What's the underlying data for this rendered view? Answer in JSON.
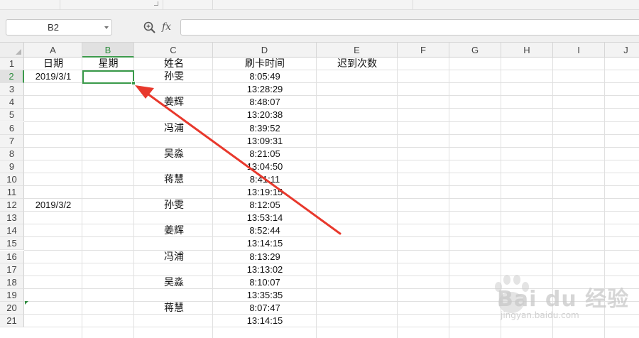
{
  "namebox": {
    "value": "B2"
  },
  "formula": {
    "fx_label": "fx",
    "value": ""
  },
  "columns": [
    "A",
    "B",
    "C",
    "D",
    "E",
    "F",
    "G",
    "H",
    "I",
    "J"
  ],
  "rows": [
    "1",
    "2",
    "3",
    "4",
    "5",
    "6",
    "7",
    "8",
    "9",
    "10",
    "11",
    "12",
    "13",
    "14",
    "15",
    "16",
    "17",
    "18",
    "19",
    "20",
    "21"
  ],
  "active_cell": "B2",
  "cells": {
    "A1": "日期",
    "B1": "星期",
    "C1": "姓名",
    "D1": "刷卡时间",
    "E1": "迟到次数",
    "A2": "2019/3/1",
    "C2": "孙雯",
    "D2": "8:05:49",
    "D3": "13:28:29",
    "C4": "姜辉",
    "D4": "8:48:07",
    "D5": "13:20:38",
    "C6": "冯浦",
    "D6": "8:39:52",
    "D7": "13:09:31",
    "C8": "吴淼",
    "D8": "8:21:05",
    "D9": "13:04:50",
    "C10": "蒋慧",
    "D10": "8:41:11",
    "D11": "13:19:15",
    "A12": "2019/3/2",
    "C12": "孙雯",
    "D12": "8:12:05",
    "D13": "13:53:14",
    "C14": "姜辉",
    "D14": "8:52:44",
    "D15": "13:14:15",
    "C16": "冯浦",
    "D16": "8:13:29",
    "D17": "13:13:02",
    "C18": "吴淼",
    "D18": "8:10:07",
    "D19": "13:35:35",
    "C20": "蒋慧",
    "D20": "8:07:47",
    "D21": "13:14:15"
  },
  "watermark": {
    "brand": "Bai du 经验",
    "site": "jingyan.baidu.com"
  },
  "colors": {
    "accent_green": "#3a9a4a",
    "arrow_red": "#e8382c"
  },
  "icons": {
    "zoom": "zoom-icon",
    "fx": "fx-icon",
    "dropdown": "chevron-down-icon"
  }
}
